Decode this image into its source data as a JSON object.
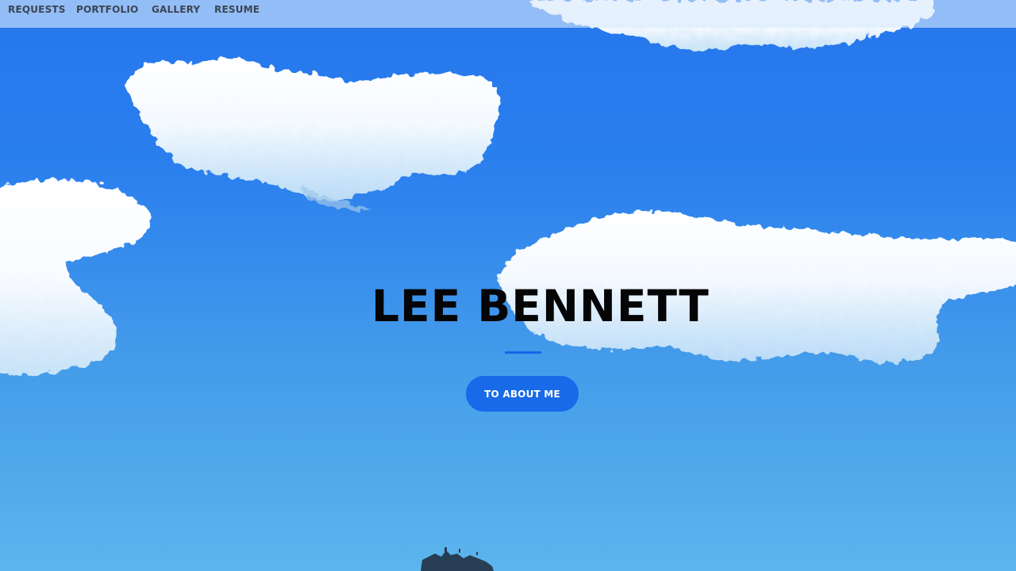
{
  "nav": {
    "items": [
      {
        "label": "REQUESTS"
      },
      {
        "label": "PORTFOLIO"
      },
      {
        "label": "GALLERY"
      },
      {
        "label": "RESUME"
      }
    ]
  },
  "hero": {
    "title": "LEE BENNETT",
    "cta_label": "TO ABOUT ME"
  },
  "colors": {
    "sky_top": "#2576ec",
    "sky_bottom": "#5cb5ec",
    "accent": "#186ae8",
    "nav_text": "#3a4552",
    "title_text": "#050505"
  }
}
